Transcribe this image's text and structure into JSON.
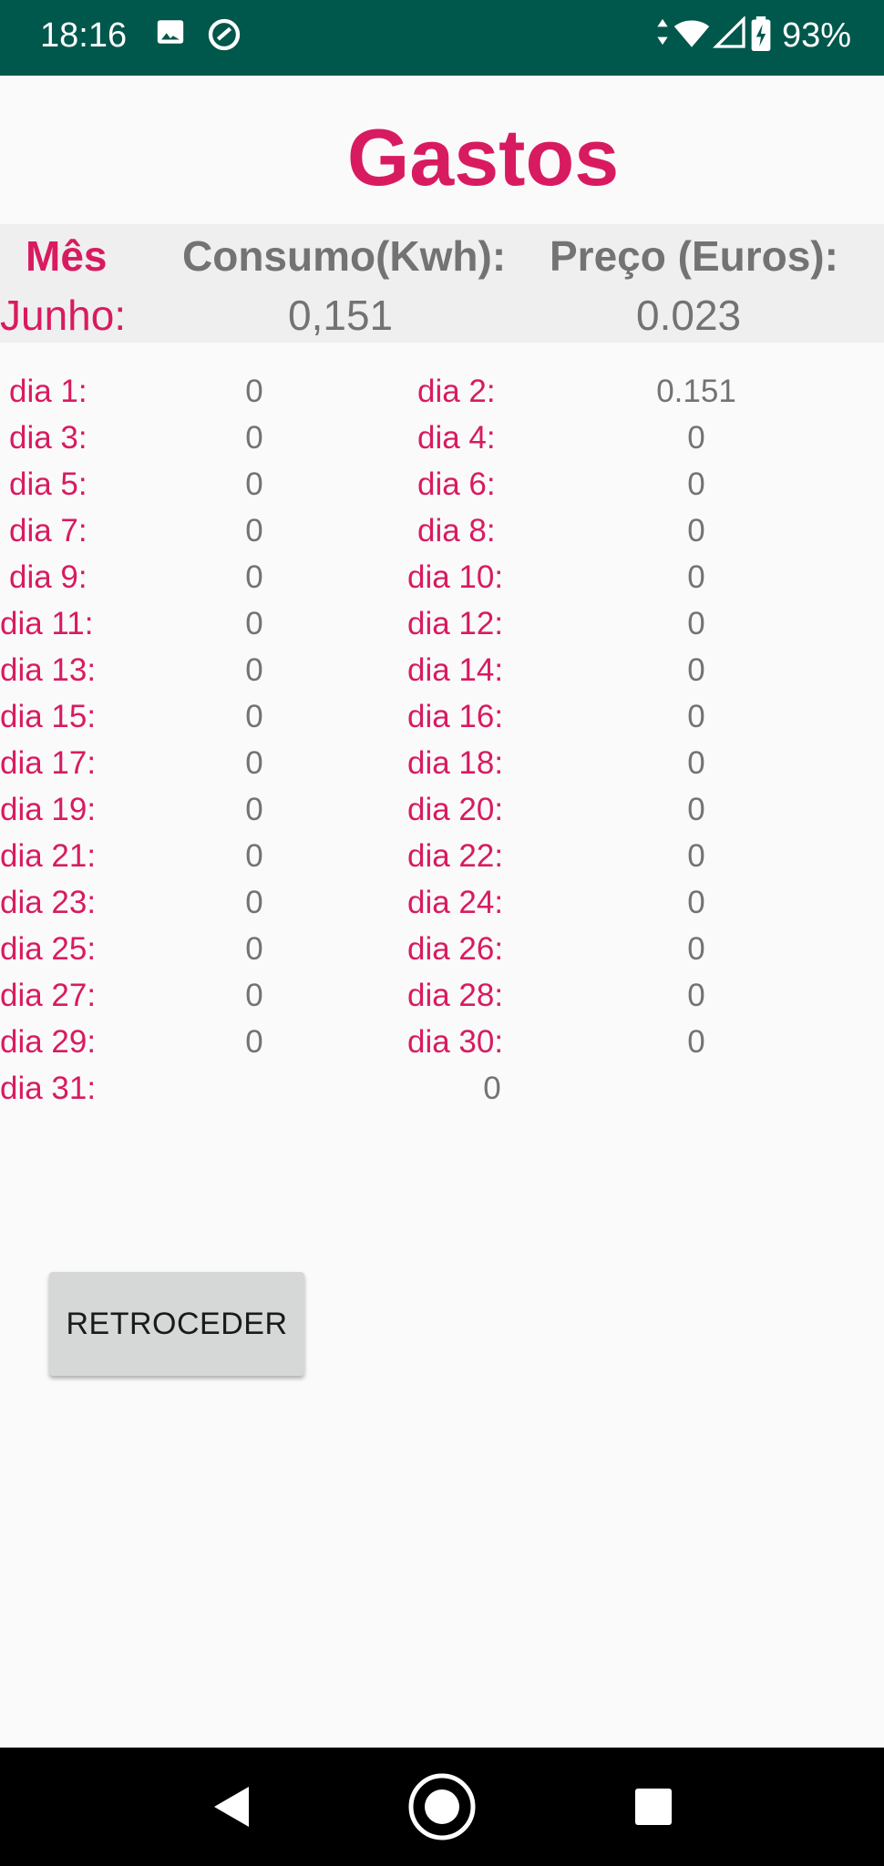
{
  "status_bar": {
    "time": "18:16",
    "battery": "93%",
    "icons": [
      "image-icon",
      "sync-icon",
      "data-arrows-icon",
      "wifi-icon",
      "signal-icon",
      "battery-icon"
    ]
  },
  "title": "Gastos",
  "summary": {
    "headers": {
      "month": "Mês",
      "consumption": "Consumo(Kwh):",
      "price": "Preço (Euros):"
    },
    "month": "Junho:",
    "consumption": "0,151",
    "price": "0.023"
  },
  "days": [
    {
      "left": {
        "label": "dia 1:",
        "value": "0"
      },
      "right": {
        "label": "dia 2:",
        "value": "0.151"
      }
    },
    {
      "left": {
        "label": "dia 3:",
        "value": "0"
      },
      "right": {
        "label": "dia 4:",
        "value": "0"
      }
    },
    {
      "left": {
        "label": "dia 5:",
        "value": "0"
      },
      "right": {
        "label": "dia 6:",
        "value": "0"
      }
    },
    {
      "left": {
        "label": "dia 7:",
        "value": "0"
      },
      "right": {
        "label": "dia 8:",
        "value": "0"
      }
    },
    {
      "left": {
        "label": "dia 9:",
        "value": "0"
      },
      "right": {
        "label": "dia 10:",
        "value": "0"
      }
    },
    {
      "left": {
        "label": "dia 11:",
        "value": "0"
      },
      "right": {
        "label": "dia 12:",
        "value": "0"
      }
    },
    {
      "left": {
        "label": "dia 13:",
        "value": "0"
      },
      "right": {
        "label": "dia 14:",
        "value": "0"
      }
    },
    {
      "left": {
        "label": "dia 15:",
        "value": "0"
      },
      "right": {
        "label": "dia 16:",
        "value": "0"
      }
    },
    {
      "left": {
        "label": "dia 17:",
        "value": "0"
      },
      "right": {
        "label": "dia 18:",
        "value": "0"
      }
    },
    {
      "left": {
        "label": "dia 19:",
        "value": "0"
      },
      "right": {
        "label": "dia 20:",
        "value": "0"
      }
    },
    {
      "left": {
        "label": "dia 21:",
        "value": "0"
      },
      "right": {
        "label": "dia 22:",
        "value": "0"
      }
    },
    {
      "left": {
        "label": "dia 23:",
        "value": "0"
      },
      "right": {
        "label": "dia 24:",
        "value": "0"
      }
    },
    {
      "left": {
        "label": "dia 25:",
        "value": "0"
      },
      "right": {
        "label": "dia 26:",
        "value": "0"
      }
    },
    {
      "left": {
        "label": "dia 27:",
        "value": "0"
      },
      "right": {
        "label": "dia 28:",
        "value": "0"
      }
    },
    {
      "left": {
        "label": "dia 29:",
        "value": "0"
      },
      "right": {
        "label": "dia 30:",
        "value": "0"
      }
    }
  ],
  "last_day": {
    "label": "dia 31:",
    "value": "0"
  },
  "back_button": "RETROCEDER",
  "colors": {
    "accent": "#d81b60",
    "status_bar": "#00574b",
    "value_text": "#737373",
    "summary_bg": "#efefef"
  },
  "nav_bar": {
    "icons": [
      "back-icon",
      "home-icon",
      "recents-icon"
    ]
  }
}
